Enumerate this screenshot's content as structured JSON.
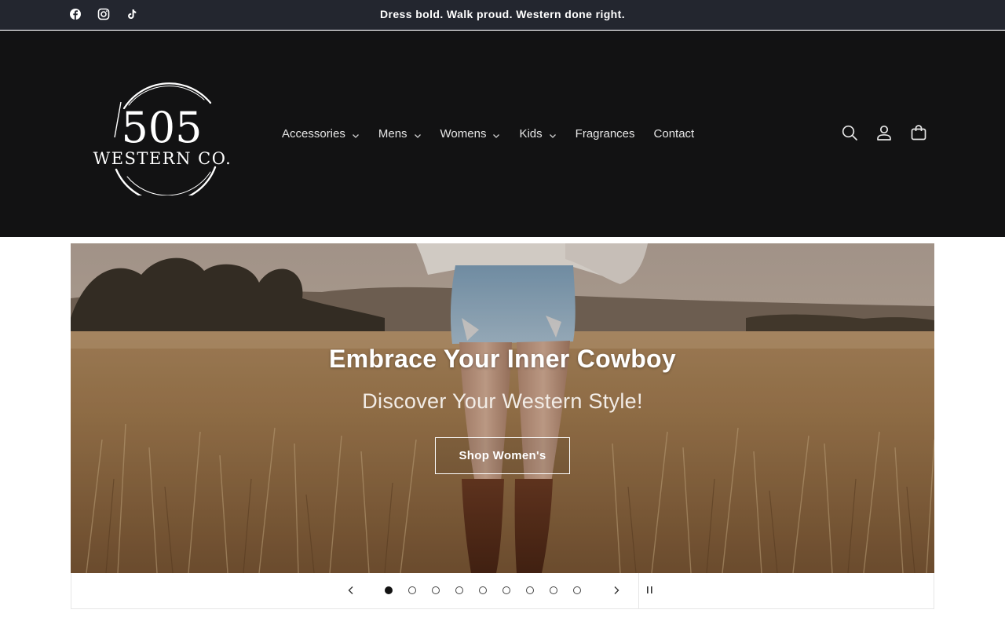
{
  "announcement": {
    "text": "Dress bold. Walk proud. Western done right.",
    "social": [
      {
        "icon": "facebook-icon"
      },
      {
        "icon": "instagram-icon"
      },
      {
        "icon": "tiktok-icon"
      }
    ]
  },
  "header": {
    "logo": {
      "number": "505",
      "name": "WESTERN CO."
    },
    "nav": [
      {
        "label": "Accessories",
        "has_dropdown": true
      },
      {
        "label": "Mens",
        "has_dropdown": true
      },
      {
        "label": "Womens",
        "has_dropdown": true
      },
      {
        "label": "Kids",
        "has_dropdown": true
      },
      {
        "label": "Fragrances",
        "has_dropdown": false
      },
      {
        "label": "Contact",
        "has_dropdown": false
      }
    ],
    "icons": [
      "search-icon",
      "account-icon",
      "cart-icon"
    ]
  },
  "hero": {
    "title": "Embrace Your Inner Cowboy",
    "subtitle": "Discover Your Western Style!",
    "button_label": "Shop Women's"
  },
  "slideshow": {
    "slide_count": 9,
    "active_slide": 1
  },
  "colors": {
    "announcement_bg": "#23262f",
    "header_bg": "#121213",
    "text_light": "#ffffff"
  }
}
